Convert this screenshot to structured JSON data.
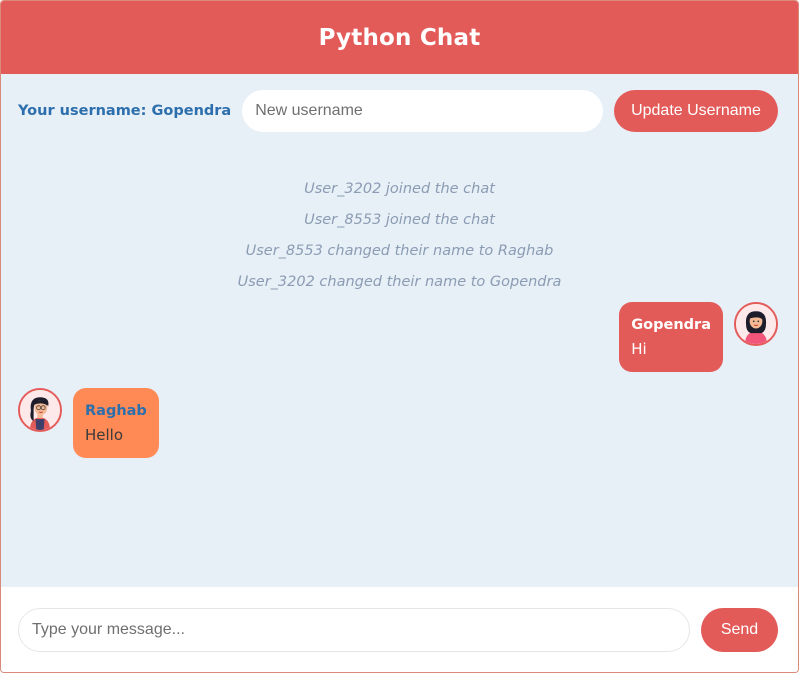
{
  "header": {
    "title": "Python Chat"
  },
  "user_bar": {
    "username_label": "Your username: Gopendra",
    "username_placeholder": "New username",
    "update_label": "Update Username"
  },
  "system_messages": [
    "User_3202 joined the chat",
    "User_8553 joined the chat",
    "User_8553 changed their name to Raghab",
    "User_3202 changed their name to Gopendra"
  ],
  "messages": [
    {
      "sender": "Gopendra",
      "text": "Hi",
      "own": true,
      "avatar_icon": "woman-avatar-icon"
    },
    {
      "sender": "Raghab",
      "text": "Hello",
      "own": false,
      "avatar_icon": "woman-avatar-icon"
    }
  ],
  "input_bar": {
    "message_placeholder": "Type your message...",
    "send_label": "Send"
  },
  "colors": {
    "primary": "#e35b59",
    "background": "#e7eff7",
    "username_blue": "#2d6fad",
    "other_bubble": "#ff8a55",
    "system_text": "#8b9cb3"
  }
}
